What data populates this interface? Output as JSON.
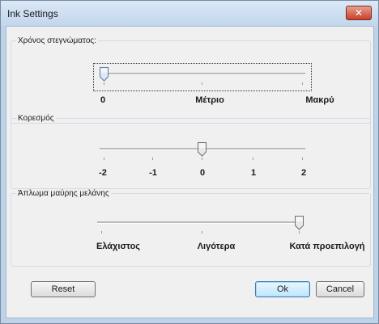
{
  "window": {
    "title": "Ink Settings",
    "close_glyph": "✕"
  },
  "groups": [
    {
      "label": "Χρόνος στεγνώματος:",
      "slider_value_index": 0,
      "tick_labels": [
        "0",
        "Μέτριο",
        "Μακρύ"
      ]
    },
    {
      "label": "Κορεσμός",
      "slider_value_index": 2,
      "tick_labels": [
        "-2",
        "-1",
        "0",
        "1",
        "2"
      ]
    },
    {
      "label": "Άπλωμα μαύρης μελάνης",
      "slider_value_index": 2,
      "tick_labels": [
        "Ελάχιστος",
        "Λιγότερα",
        "Κατά προεπιλογή"
      ]
    }
  ],
  "buttons": {
    "reset": "Reset",
    "ok": "Ok",
    "cancel": "Cancel"
  }
}
